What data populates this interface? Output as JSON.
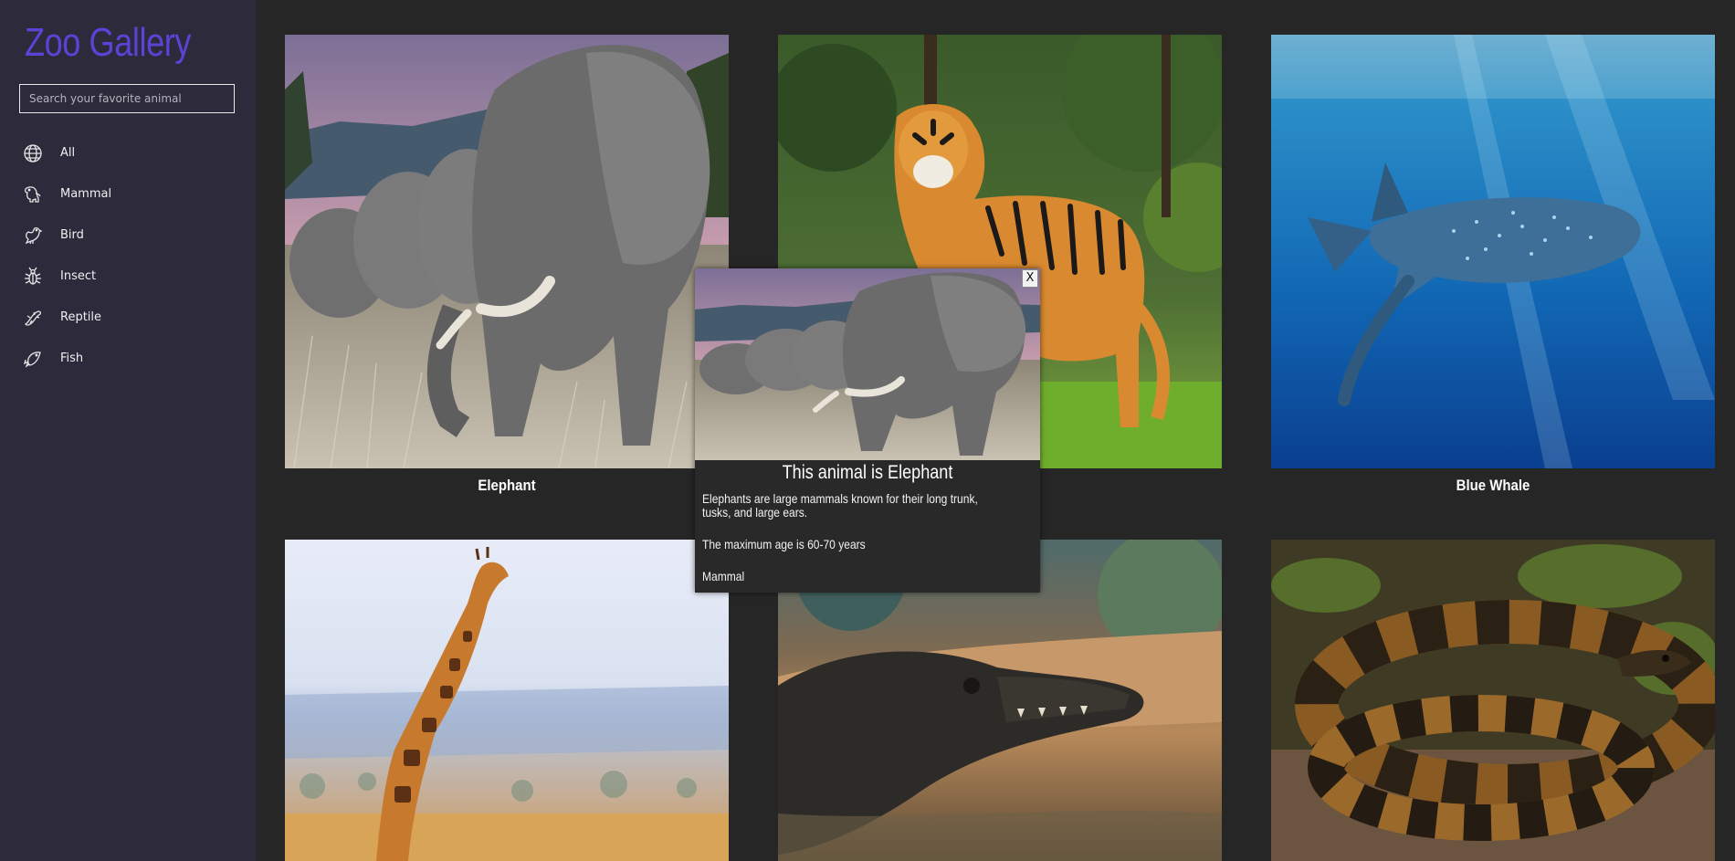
{
  "sidebar": {
    "title": "Zoo Gallery",
    "search": {
      "placeholder": "Search your favorite animal",
      "value": ""
    },
    "items": [
      {
        "label": "All",
        "icon": "globe-icon"
      },
      {
        "label": "Mammal",
        "icon": "mammal-icon"
      },
      {
        "label": "Bird",
        "icon": "bird-icon"
      },
      {
        "label": "Insect",
        "icon": "insect-icon"
      },
      {
        "label": "Reptile",
        "icon": "reptile-icon"
      },
      {
        "label": "Fish",
        "icon": "fish-icon"
      }
    ]
  },
  "gallery": {
    "cards": [
      {
        "name": "Elephant",
        "image": "elephant-photo"
      },
      {
        "name": "",
        "image": "tiger-photo"
      },
      {
        "name": "Blue Whale",
        "image": "whale-shark-photo"
      },
      {
        "name": "",
        "image": "giraffe-photo"
      },
      {
        "name": "",
        "image": "crocodile-photo"
      },
      {
        "name": "",
        "image": "python-photo"
      }
    ]
  },
  "modal": {
    "title": "This animal is Elephant",
    "description": "Elephants are large mammals known for their long trunk, tusks, and large ears.",
    "max_age": "The maximum age is 60-70 years",
    "category": "Mammal",
    "close_label": "X",
    "image": "elephant-photo"
  },
  "colors": {
    "accent": "#5b43d6",
    "sidebar_bg": "#2c2a3b",
    "page_bg": "#262626"
  }
}
